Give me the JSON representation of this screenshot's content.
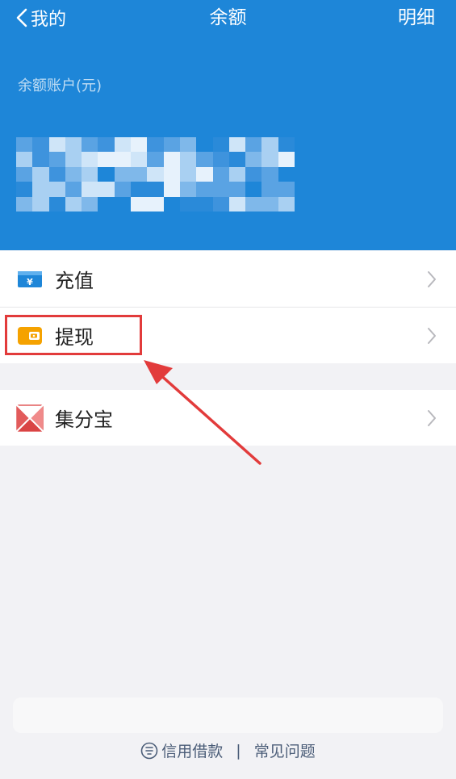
{
  "nav": {
    "back_label": "我的",
    "title": "余额",
    "detail_label": "明细"
  },
  "balance": {
    "label": "余额账户(元)",
    "amount_obscured": true
  },
  "list_groups": [
    {
      "items": [
        {
          "label": "充值",
          "icon": "yuan-card-icon",
          "icon_color": "#1e86d8"
        },
        {
          "label": "提现",
          "icon": "wallet-icon",
          "icon_color": "#f5a200"
        }
      ]
    },
    {
      "items": [
        {
          "label": "集分宝",
          "icon": "jifenbao-icon",
          "icon_color": "#e25b5b"
        }
      ]
    }
  ],
  "footer": {
    "credit_link": "信用借款",
    "separator": "|",
    "faq_link": "常见问题"
  },
  "colors": {
    "header_bg": "#1e86d8",
    "page_bg": "#f2f2f5",
    "annotation": "#e23b3b",
    "footer_text": "#4b5d78"
  }
}
